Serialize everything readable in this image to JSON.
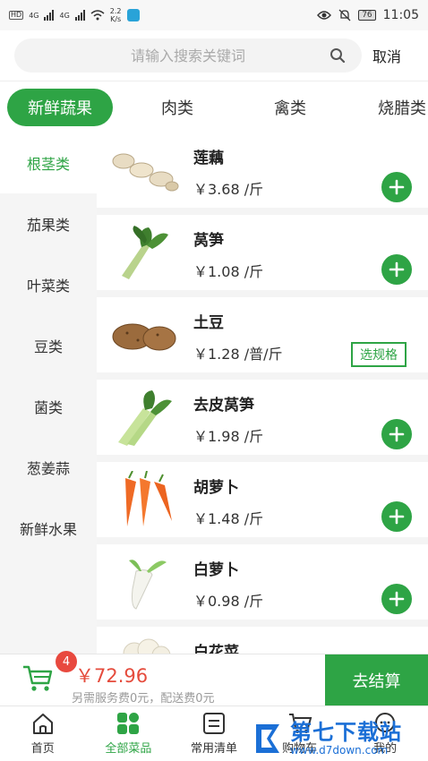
{
  "status_bar": {
    "hd1": "HD",
    "hd2": "HD",
    "net1": "4G",
    "net2": "4G",
    "speed_value": "2.2",
    "speed_unit": "K/s",
    "battery": "76",
    "time": "11:05"
  },
  "search": {
    "placeholder": "请输入搜索关键词",
    "cancel_label": "取消"
  },
  "tabs": [
    {
      "label": "新鲜蔬果"
    },
    {
      "label": "肉类"
    },
    {
      "label": "禽类"
    },
    {
      "label": "烧腊类"
    }
  ],
  "sidebar": {
    "items": [
      {
        "label": "根茎类"
      },
      {
        "label": "茄果类"
      },
      {
        "label": "叶菜类"
      },
      {
        "label": "豆类"
      },
      {
        "label": "菌类"
      },
      {
        "label": "葱姜蒜"
      },
      {
        "label": "新鲜水果"
      }
    ]
  },
  "products": [
    {
      "name": "莲藕",
      "price": "￥3.68 /斤"
    },
    {
      "name": "莴笋",
      "price": "￥1.08 /斤"
    },
    {
      "name": "土豆",
      "price": "￥1.28 /普/斤",
      "spec_label": "选规格"
    },
    {
      "name": "去皮莴笋",
      "price": "￥1.98 /斤"
    },
    {
      "name": "胡萝卜",
      "price": "￥1.48 /斤"
    },
    {
      "name": "白萝卜",
      "price": "￥0.98 /斤"
    },
    {
      "name": "白花菜",
      "price": ""
    }
  ],
  "cart": {
    "count": "4",
    "total": "￥72.96",
    "fee_note": "另需服务费0元，配送费0元",
    "checkout_label": "去结算"
  },
  "bottom_nav": [
    {
      "label": "首页"
    },
    {
      "label": "全部菜品"
    },
    {
      "label": "常用清单"
    },
    {
      "label": "购物车"
    },
    {
      "label": "我的"
    }
  ],
  "watermark": {
    "title": "第七下载站",
    "url": "www.d7down.com"
  },
  "colors": {
    "accent": "#2ea445",
    "price_red": "#e54b3c",
    "badge_red": "#e8493f",
    "watermark_blue": "#1b6fd6"
  }
}
